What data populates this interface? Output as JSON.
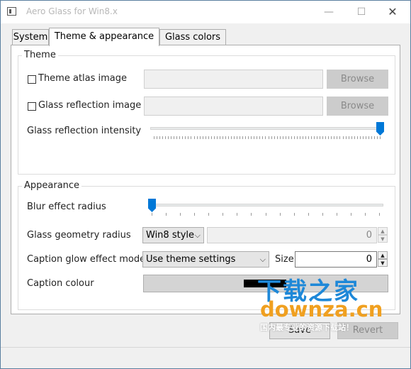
{
  "window": {
    "title": "Aero Glass for Win8.x",
    "minimize_glyph": "—",
    "maximize_glyph": "☐",
    "close_glyph": "✕"
  },
  "tabs": [
    {
      "label": "System",
      "active": false
    },
    {
      "label": "Theme & appearance",
      "active": true
    },
    {
      "label": "Glass colors",
      "active": false
    }
  ],
  "theme": {
    "title": "Theme",
    "atlas_label": "Theme atlas image",
    "atlas_checked": false,
    "atlas_value": "",
    "atlas_browse": "Browse",
    "reflection_label": "Glass reflection image",
    "reflection_checked": false,
    "reflection_value": "",
    "reflection_browse": "Browse",
    "intensity_label": "Glass reflection intensity",
    "intensity_level": 1.0
  },
  "appearance": {
    "title": "Appearance",
    "blur_label": "Blur effect radius",
    "blur_level": 0.0,
    "geometry_label": "Glass geometry radius",
    "geometry_style": "Win8 style",
    "geometry_value": "0",
    "glow_label": "Caption glow effect mode",
    "glow_mode": "Use theme settings",
    "size_label": "Size",
    "size_value": "0",
    "colour_label": "Caption colour",
    "colour_value": "#000000"
  },
  "buttons": {
    "save": "Save",
    "revert": "Revert"
  },
  "watermark": {
    "brand": "下载之家",
    "url": "downza.cn",
    "tagline": "国内最专业的资源下载站！"
  },
  "colors": {
    "accent": "#0078d7",
    "desktop": "#1a5a8c"
  }
}
